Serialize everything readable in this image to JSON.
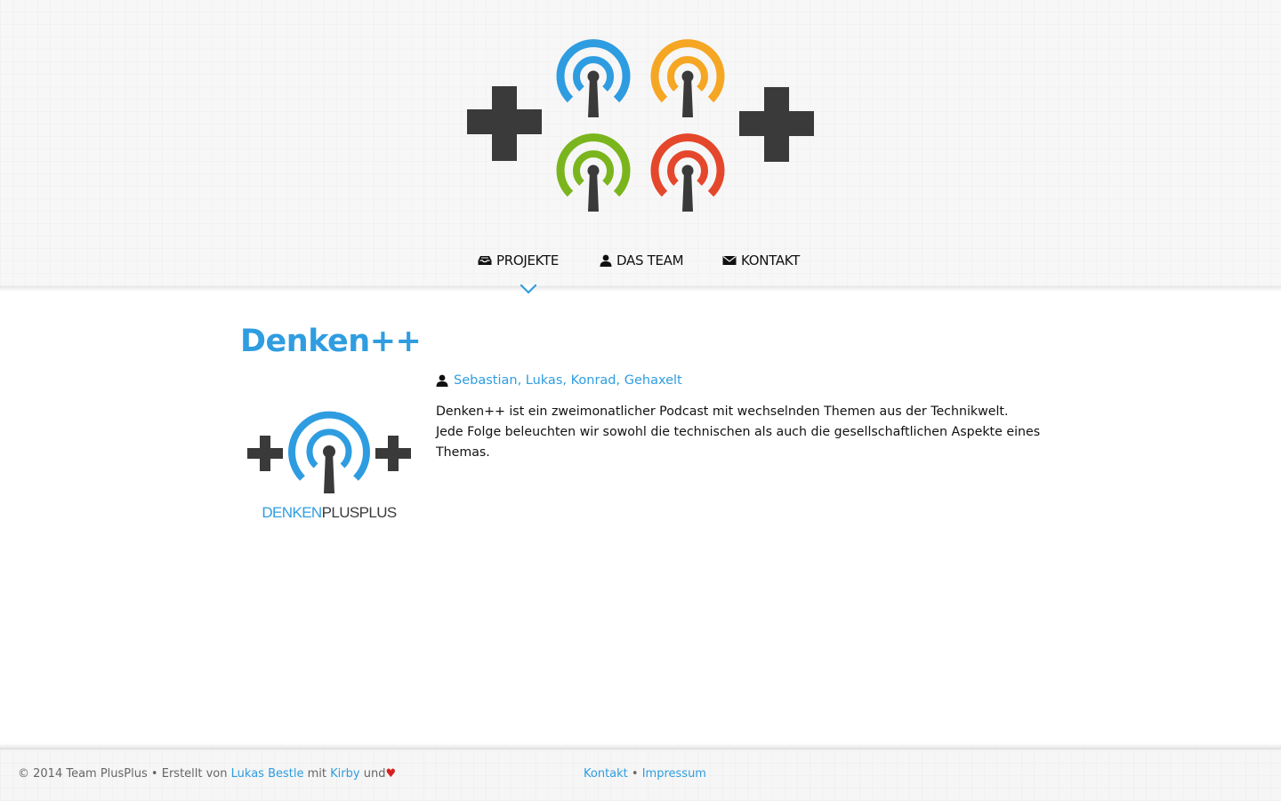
{
  "colors": {
    "accent": "#2f9de0",
    "logo_blue": "#2e9ce0",
    "logo_orange": "#f5a623",
    "logo_green": "#7ab51d",
    "logo_red": "#e4472b",
    "plus_dark": "#3a3a3a",
    "heart": "#d81e1e"
  },
  "header": {
    "logo_icons": [
      "plus-icon",
      "podcast-blue-icon",
      "podcast-orange-icon",
      "podcast-green-icon",
      "podcast-red-icon",
      "plus-icon"
    ]
  },
  "nav": {
    "items": [
      {
        "label": "PROJEKTE",
        "icon": "inbox-icon",
        "active": true
      },
      {
        "label": "DAS TEAM",
        "icon": "user-icon",
        "active": false
      },
      {
        "label": "KONTAKT",
        "icon": "envelope-icon",
        "active": false
      }
    ]
  },
  "project": {
    "title": "Denken++",
    "logo_text_part1": "DENKEN",
    "logo_text_part2": "PLUSPLUS",
    "authors": [
      "Sebastian",
      "Lukas",
      "Konrad",
      "Gehaxelt"
    ],
    "authors_separator": ", ",
    "description": [
      "Denken++ ist ein zweimonatlicher Podcast mit wechselnden Themen aus der Technikwelt.",
      "Jede Folge beleuchten wir sowohl die technischen als auch die gesellschaftlichen Aspekte eines Themas."
    ]
  },
  "footer": {
    "copyright": "© 2014 Team PlusPlus",
    "bullet": "•",
    "created_by": "Erstellt von",
    "author_link": "Lukas Bestle",
    "with": "mit",
    "cms_link": "Kirby",
    "and": "und",
    "heart": "♥",
    "contact_link": "Kontakt",
    "imprint_link": "Impressum"
  }
}
